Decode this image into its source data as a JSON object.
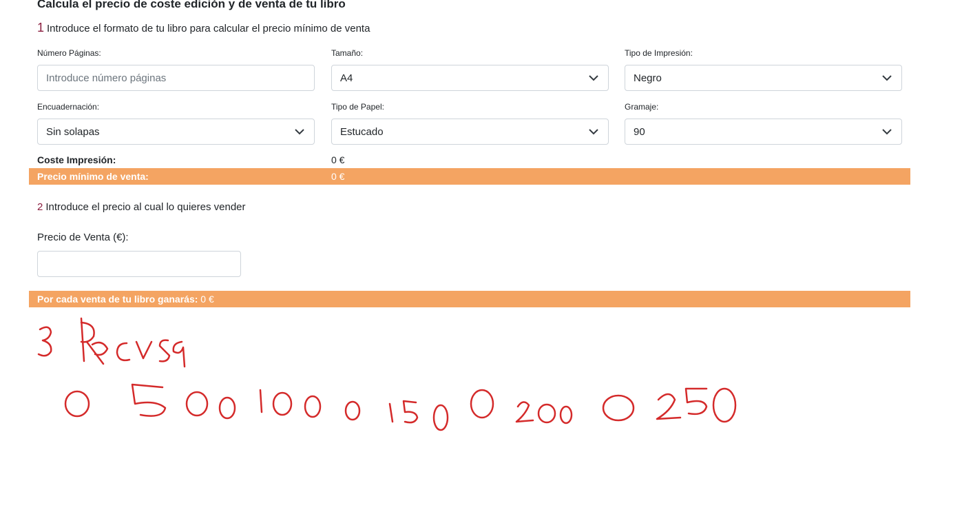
{
  "header": {
    "title": "Calcula el precio de coste edición y de venta de tu libro"
  },
  "step1": {
    "number": "1",
    "text": "Introduce el formato de tu libro para calcular el precio mínimo de venta"
  },
  "fields": {
    "paginas": {
      "label": "Número Páginas:",
      "placeholder": "Introduce número páginas"
    },
    "tamano": {
      "label": "Tamaño:",
      "value": "A4"
    },
    "impresion": {
      "label": "Tipo de Impresión:",
      "value": "Negro"
    },
    "encuadernacion": {
      "label": "Encuadernación:",
      "value": "Sin solapas"
    },
    "papel": {
      "label": "Tipo de Papel:",
      "value": "Estucado"
    },
    "gramaje": {
      "label": "Gramaje:",
      "value": "90"
    }
  },
  "coste": {
    "label": "Coste Impresión:",
    "value": "0 €"
  },
  "precio_minimo": {
    "label": "Precio mínimo de venta:",
    "value": "0 €"
  },
  "step2": {
    "number": "2",
    "text": "Introduce el precio al cual lo quieres vender"
  },
  "precio_venta": {
    "label": "Precio de Venta (€):",
    "value": ""
  },
  "ganancia": {
    "label": "Por cada venta de tu libro ganarás:",
    "value": "0 €"
  },
  "colors": {
    "accent_bar": "#f4a462",
    "step_number": "#8b1e3f",
    "handwriting": "#d42a2a"
  }
}
